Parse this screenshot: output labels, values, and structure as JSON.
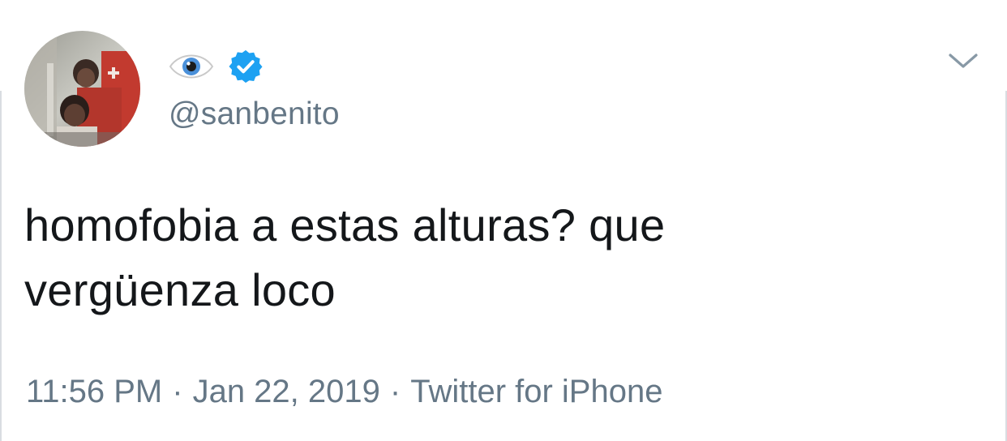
{
  "author": {
    "display_name_icon": "eye-icon",
    "verified_icon": "verified-badge-icon",
    "handle": "@sanbenito",
    "avatar": "avatar-photo"
  },
  "menu": {
    "icon": "chevron-down-icon"
  },
  "tweet": {
    "text": "homofobia a estas alturas? que\nvergüenza loco"
  },
  "meta": {
    "time": "11:56 PM",
    "separator": "·",
    "date": "Jan 22, 2019",
    "source": "Twitter for iPhone"
  },
  "colors": {
    "text": "#14171a",
    "secondary": "#657786",
    "verified": "#1da1f2",
    "eye_iris": "#4a90d9"
  }
}
